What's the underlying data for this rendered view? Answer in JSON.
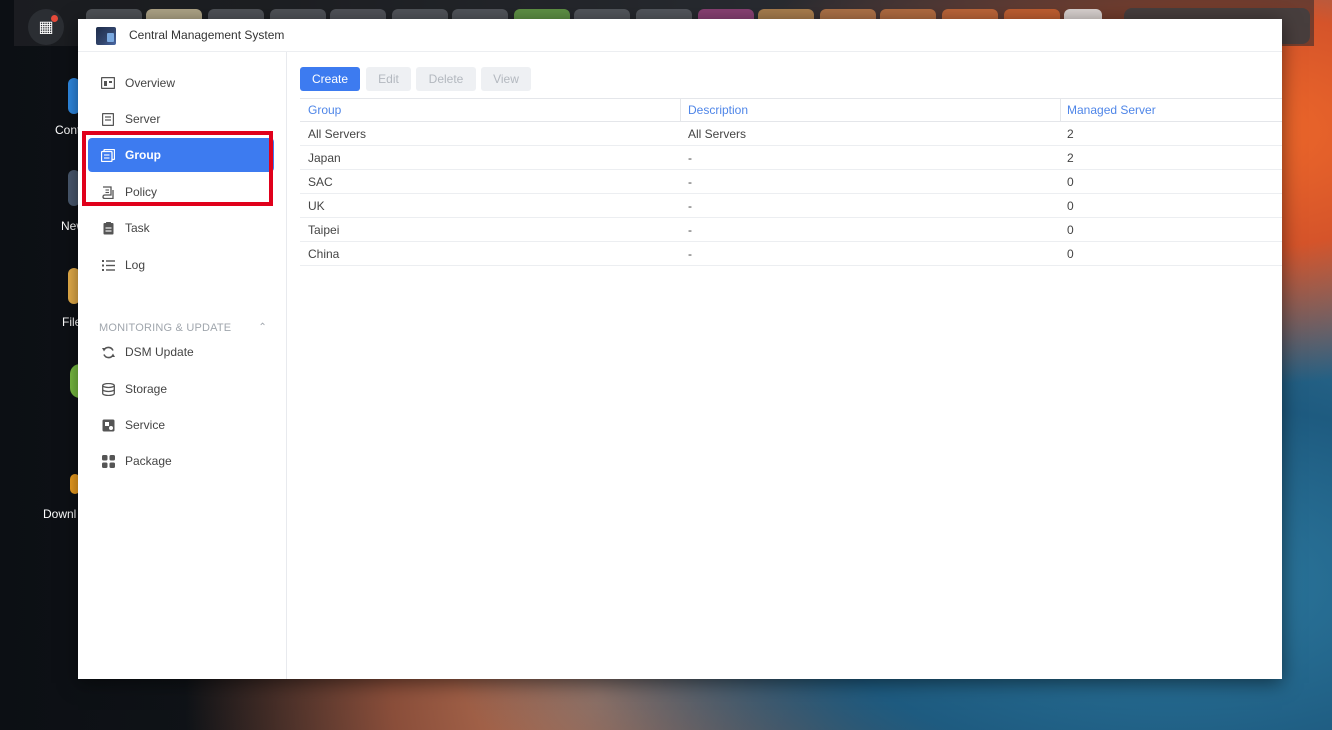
{
  "window": {
    "title": "Central Management System"
  },
  "desktop": {
    "labels": [
      "Cont",
      "New",
      "File",
      "Downl"
    ]
  },
  "sidebar": {
    "items": [
      {
        "label": "Overview",
        "icon": "overview-icon",
        "active": false
      },
      {
        "label": "Server",
        "icon": "server-icon",
        "active": false
      },
      {
        "label": "Group",
        "icon": "group-icon",
        "active": true
      },
      {
        "label": "Policy",
        "icon": "policy-icon",
        "active": false
      },
      {
        "label": "Task",
        "icon": "task-icon",
        "active": false
      },
      {
        "label": "Log",
        "icon": "log-icon",
        "active": false
      }
    ],
    "section_header": "MONITORING & UPDATE",
    "section_items": [
      {
        "label": "DSM Update",
        "icon": "refresh-icon"
      },
      {
        "label": "Storage",
        "icon": "storage-icon"
      },
      {
        "label": "Service",
        "icon": "service-icon"
      },
      {
        "label": "Package",
        "icon": "package-icon"
      }
    ]
  },
  "toolbar": {
    "create_label": "Create",
    "edit_label": "Edit",
    "delete_label": "Delete",
    "view_label": "View"
  },
  "table": {
    "columns": [
      "Group",
      "Description",
      "Managed Server"
    ],
    "rows": [
      [
        "All Servers",
        "All Servers",
        "2"
      ],
      [
        "Japan",
        "-",
        "2"
      ],
      [
        "SAC",
        "-",
        "0"
      ],
      [
        "UK",
        "-",
        "0"
      ],
      [
        "Taipei",
        "-",
        "0"
      ],
      [
        "China",
        "-",
        "0"
      ]
    ]
  },
  "colors": {
    "accent": "#3d7bf0",
    "highlight": "#e0001b",
    "header_text": "#4f86e8"
  }
}
